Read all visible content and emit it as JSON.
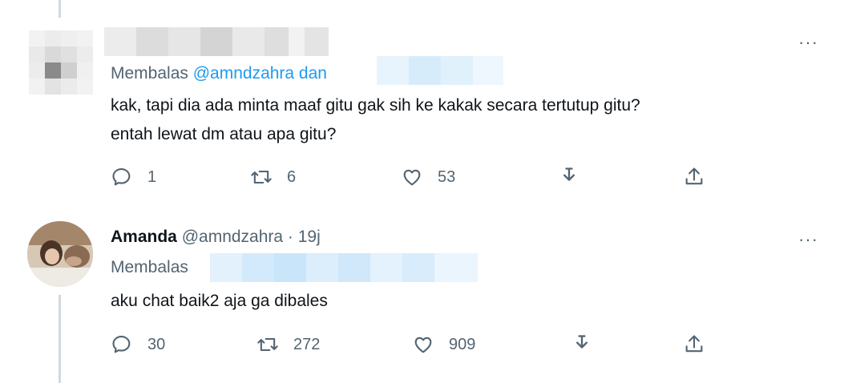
{
  "tweet1": {
    "reply_prefix": "Membalas",
    "reply_mention": "@amndzahra dan",
    "text_line1": "kak, tapi dia ada minta maaf gitu gak sih ke kakak secara tertutup gitu?",
    "text_line2": "entah lewat dm atau apa gitu?",
    "more_label": "···",
    "actions": {
      "replies": "1",
      "retweets": "6",
      "likes": "53"
    }
  },
  "tweet2": {
    "display_name": "Amanda",
    "handle_meta": "@amndzahra · 19j",
    "reply_prefix": "Membalas",
    "text": "aku chat baik2 aja ga dibales",
    "more_label": "···",
    "actions": {
      "replies": "30",
      "retweets": "272",
      "likes": "909"
    }
  },
  "icons": {
    "reply": "reply-icon",
    "retweet": "retweet-icon",
    "like": "heart-icon",
    "download": "download-icon",
    "share": "share-icon"
  },
  "colors": {
    "text_primary": "#0f1419",
    "text_secondary": "#536471",
    "mention": "#1d9bf0",
    "thread_line": "#cfd9de"
  }
}
